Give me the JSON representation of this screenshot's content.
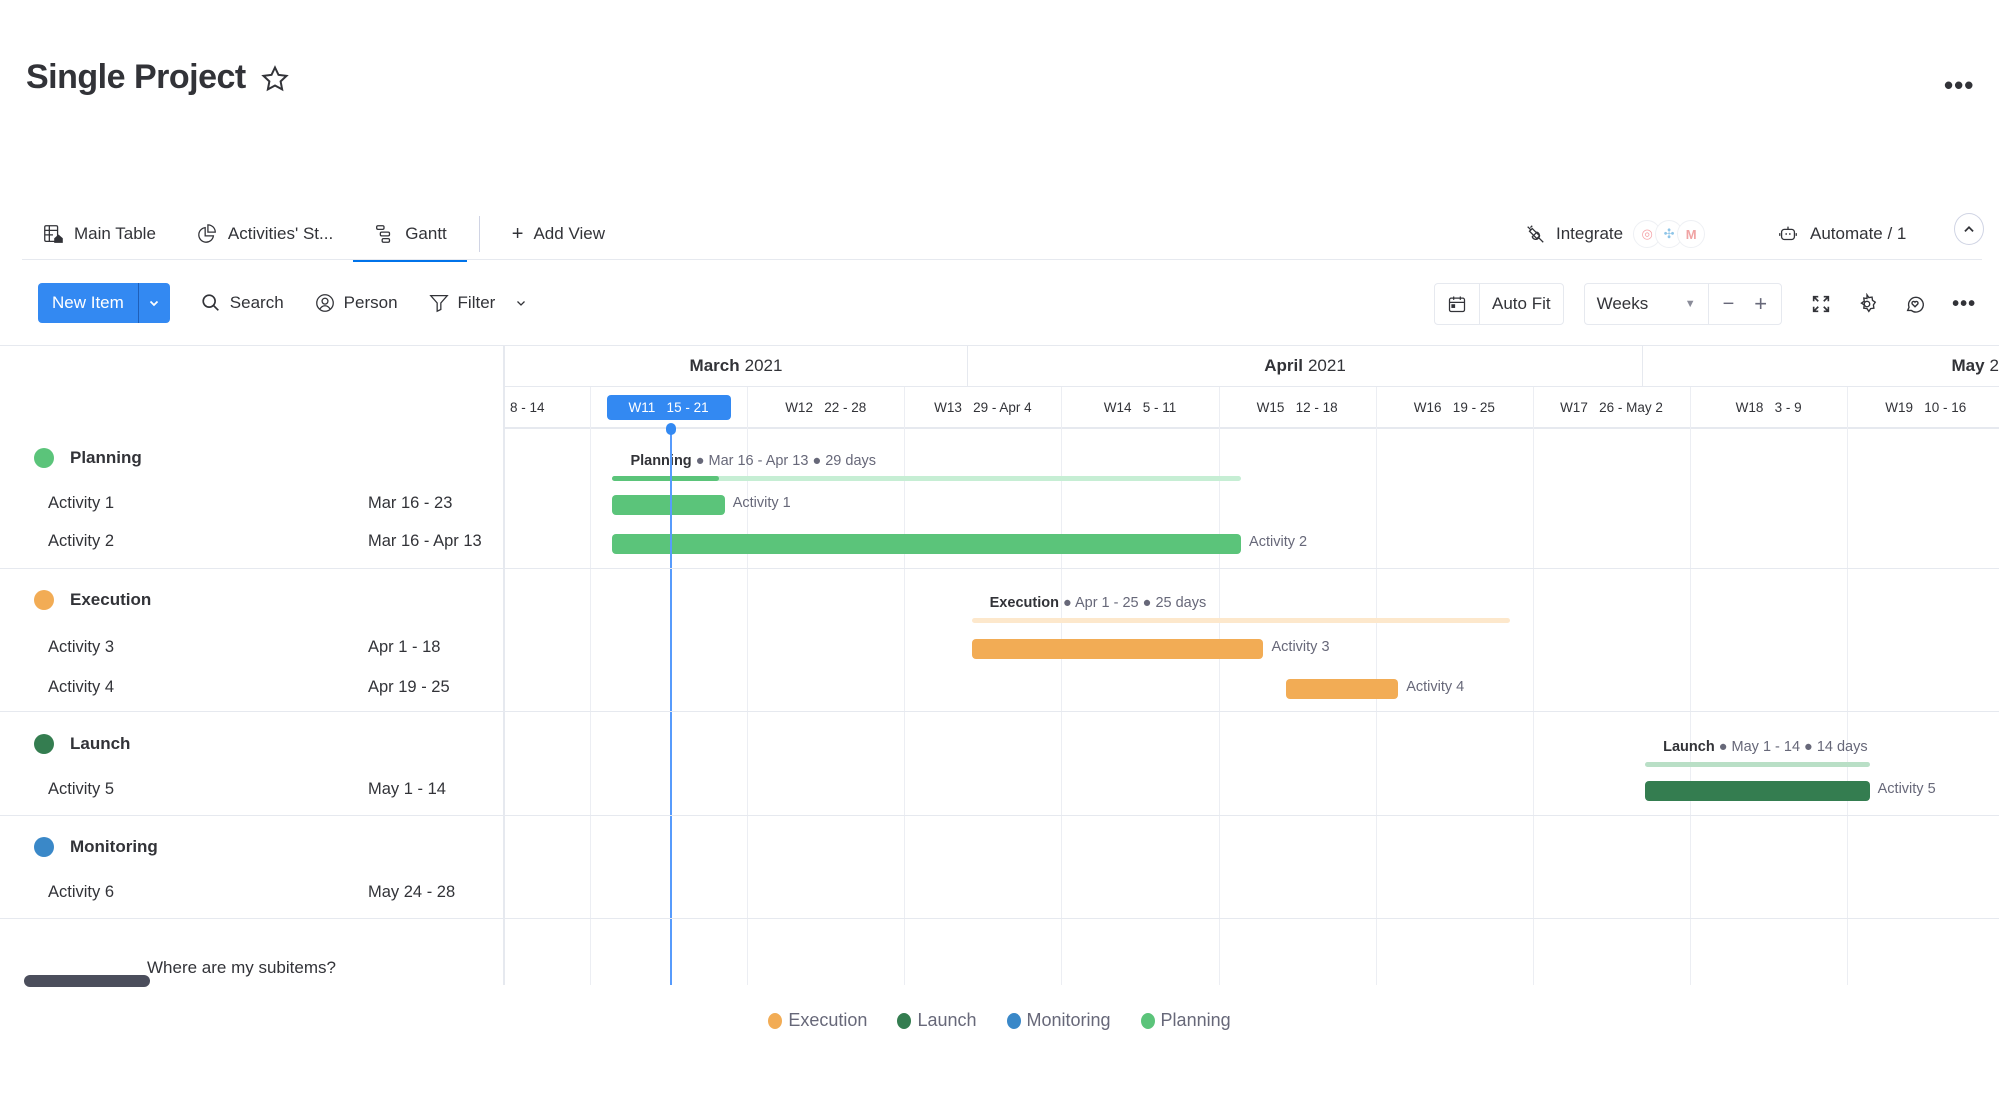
{
  "header": {
    "title": "Single Project",
    "more_label": "•••"
  },
  "tabs": [
    {
      "label": "Main Table",
      "icon": "table-home-icon",
      "active": false
    },
    {
      "label": "Activities' St...",
      "icon": "pie-chart-icon",
      "active": false
    },
    {
      "label": "Gantt",
      "icon": "gantt-icon",
      "active": true
    }
  ],
  "add_view_label": "Add View",
  "integrate_label": "Integrate",
  "automate_label": "Automate / 1",
  "toolbar": {
    "new_item_label": "New Item",
    "search_label": "Search",
    "person_label": "Person",
    "filter_label": "Filter",
    "auto_fit_label": "Auto Fit",
    "scale_label": "Weeks",
    "zoom_out_label": "−",
    "zoom_in_label": "+"
  },
  "timeline": {
    "months": [
      {
        "name": "March",
        "year": "2021"
      },
      {
        "name": "April",
        "year": "2021"
      },
      {
        "name": "May",
        "year": "2"
      }
    ],
    "weeks": [
      {
        "label": "8 - 14",
        "current": false
      },
      {
        "label": "W11   15 - 21",
        "current": true
      },
      {
        "label": "W12   22 - 28",
        "current": false
      },
      {
        "label": "W13   29 - Apr 4",
        "current": false
      },
      {
        "label": "W14   5 - 11",
        "current": false
      },
      {
        "label": "W15   12 - 18",
        "current": false
      },
      {
        "label": "W16   19 - 25",
        "current": false
      },
      {
        "label": "W17   26 - May 2",
        "current": false
      },
      {
        "label": "W18   3 - 9",
        "current": false
      },
      {
        "label": "W19   10 - 16",
        "current": false
      }
    ],
    "today": "2021-03-20"
  },
  "colors": {
    "Planning": "#5bc47a",
    "Planning_light": "#c6eed4",
    "Execution": "#f2ac55",
    "Execution_light": "#fde8cc",
    "Launch": "#347d50",
    "Launch_light": "#b9dfc6",
    "Monitoring": "#3a88c8",
    "accent": "#3389f2"
  },
  "groups": [
    {
      "name": "Planning",
      "summary_dates": "Mar 16 - Apr 13",
      "summary_days": "29 days",
      "start": "2021-03-16",
      "end": "2021-04-13",
      "progress": 0.17,
      "items": [
        {
          "name": "Activity 1",
          "dates": "Mar 16 - 23",
          "start": "2021-03-16",
          "end": "2021-03-21"
        },
        {
          "name": "Activity 2",
          "dates": "Mar 16 - Apr 13",
          "start": "2021-03-16",
          "end": "2021-04-13"
        }
      ]
    },
    {
      "name": "Execution",
      "summary_dates": "Apr 1 - 25",
      "summary_days": "25 days",
      "start": "2021-04-01",
      "end": "2021-04-25",
      "progress": 0,
      "items": [
        {
          "name": "Activity 3",
          "dates": "Apr 1 - 18",
          "start": "2021-04-01",
          "end": "2021-04-14"
        },
        {
          "name": "Activity 4",
          "dates": "Apr 19 - 25",
          "start": "2021-04-15",
          "end": "2021-04-20"
        }
      ]
    },
    {
      "name": "Launch",
      "summary_dates": "May 1 - 14",
      "summary_days": "14 days",
      "start": "2021-05-01",
      "end": "2021-05-11",
      "progress": 0,
      "items": [
        {
          "name": "Activity 5",
          "dates": "May 1 - 14",
          "start": "2021-05-01",
          "end": "2021-05-11"
        }
      ]
    },
    {
      "name": "Monitoring",
      "items": [
        {
          "name": "Activity 6",
          "dates": "May 24 - 28"
        }
      ]
    }
  ],
  "subitems_label": "Where are my subitems?",
  "legend": [
    "Execution",
    "Launch",
    "Monitoring",
    "Planning"
  ]
}
